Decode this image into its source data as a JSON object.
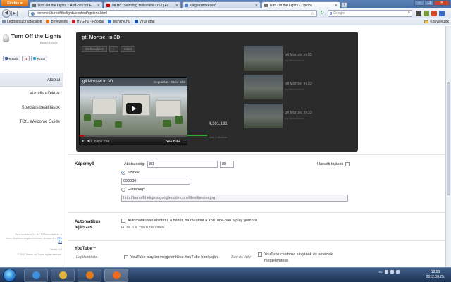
{
  "browser": {
    "menu_button": "Firefox",
    "tabs": [
      {
        "label": "Turn Off the Lights :: Add-ons for Fire...",
        "color": "#6b6b6b",
        "active": false
      },
      {
        "label": "Jai Ho\" Slumdog Millionaire OST (Fu...",
        "color": "#cc0000",
        "active": false
      },
      {
        "label": "Kiegészítőkezelő",
        "color": "#4b7bd1",
        "active": false
      },
      {
        "label": "Turn Off the Lights - Opciók",
        "color": "#6b6b6b",
        "active": true
      }
    ],
    "new_tab": "+",
    "url": "chrome://turnoffthelights/content/options.html",
    "search_engine": "g",
    "search_placeholder": "Google"
  },
  "bookmarks": {
    "items": [
      {
        "label": "Legtöbbször látogatott",
        "color": "#7a8fb0"
      },
      {
        "label": "Bevezetés",
        "color": "#e07a1f"
      },
      {
        "label": "HVG.hu - Főoldal",
        "color": "#b22"
      },
      {
        "label": "techline.hu",
        "color": "#2c7bd1"
      },
      {
        "label": "VirusTotal",
        "color": "#1a4fa5"
      }
    ],
    "right_label": "Könyvjelzők"
  },
  "sidebar": {
    "title": "Turn Off the Lights",
    "subtitle": "Beállítások",
    "social": [
      {
        "label": "Tetszik",
        "color": "#3b5998"
      },
      {
        "label": "+1",
        "color": "#d34836"
      },
      {
        "label": "Tweet",
        "color": "#2aa9e0"
      }
    ],
    "nav": [
      {
        "label": "Alapjai",
        "active": true
      },
      {
        "label": "Vizuális effektek",
        "active": false
      },
      {
        "label": "Speciális beállítások",
        "active": false
      },
      {
        "label": "TOtL Welcome Guide",
        "active": false
      }
    ],
    "footer_line1": "Ez a szoftver a CC-BY-SA licenc alatt áll. A",
    "footer_line2": "licenc részletes megismeréséhez, olvassa el a",
    "footer_link": "GPL 2.0",
    "footer_version": "Verzió: 1.0",
    "footer_copyright": "© 2012 Stefan vd. Some rights reserved."
  },
  "preview": {
    "title": "gti Mortsel in 3D",
    "channel_button": "StefanvdLive",
    "add_button": "+",
    "video_button": "Videó",
    "video": {
      "title": "gti Mortsel in 3D",
      "share": "megosztás",
      "more": "More info",
      "time": "0:00 / 2:58",
      "progress": 0.04,
      "logo": "You Tube"
    },
    "related": [
      {
        "title": "gti Mortsel in 3D",
        "sub": "by StefanvdLive"
      },
      {
        "title": "gti Mortsel in 3D",
        "sub": "by StefanvdLive"
      },
      {
        "title": "gti Mortsel in 3D",
        "sub": "by StefanvdLive"
      }
    ],
    "like_button": "Like",
    "add_to_button": "+ Add to",
    "share_button": "Share",
    "views": "4,301,181",
    "views_suffix": "",
    "likes_text": "Like, 0 dislikes",
    "uploader": "gti Mortsel in a Belgium ontwerp in 3D"
  },
  "settings": {
    "screen": {
      "label": "Képernyő",
      "opacity_label": "Átlátszóság:",
      "opacity_value": "80",
      "opacity_value2": "80",
      "easter_label": "Húsvéti tojások",
      "color_option": "Színek:",
      "color_value": "000000",
      "bg_option": "Háttérkép:",
      "bg_url": "http://turnoffthelights.googlecode.com/files/theater.jpg"
    },
    "autoplay": {
      "label_line1": "Automatikus",
      "label_line2": "lejátszás",
      "checkbox_label": "Automatikusan elsötétül a háttér, ha rákattint a YouTube-ban a play gombra.",
      "sub_label": "HTML5 & YouTube video"
    },
    "youtube": {
      "label": "YouTube™",
      "playlist_heading": "Lejátszólista",
      "playlist_checkbox": "YouTube playlist megjelenítése YouTube honlapján.",
      "name_heading": "Sáv és Név",
      "name_checkbox_line1": "YouTube csatorna sávjának és nevének",
      "name_checkbox_line2": "megjelenítése."
    }
  },
  "taskbar": {
    "apps": [
      {
        "name": "ie",
        "color": "#3d8fe0"
      },
      {
        "name": "explorer",
        "color": "#e2b43b"
      },
      {
        "name": "media",
        "color": "#e07a1f"
      },
      {
        "name": "firefox",
        "color": "#f26a1b"
      }
    ],
    "language": "HU",
    "time": "18:25",
    "date": "2012.03.25."
  }
}
